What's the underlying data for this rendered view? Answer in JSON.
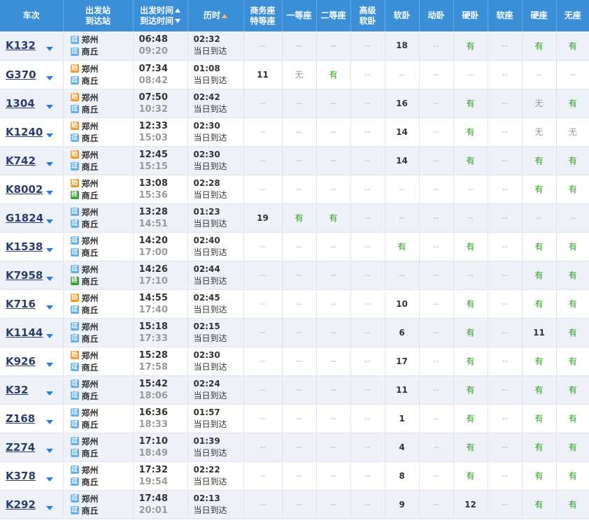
{
  "header": {
    "train": "车次",
    "from_station": "出发站",
    "to_station": "到达站",
    "dep_time": "出发时间",
    "arr_time": "到达时间",
    "duration": "历时",
    "swz_line1": "商务座",
    "swz_line2": "特等座",
    "ydz": "一等座",
    "edz": "二等座",
    "gjrw_line1": "高级",
    "gjrw_line2": "软卧",
    "rw": "软卧",
    "dw": "动卧",
    "yw": "硬卧",
    "rz": "软座",
    "yz": "硬座",
    "wz": "无座"
  },
  "badges": {
    "pass": "过",
    "start": "始",
    "end": "终"
  },
  "rows": [
    {
      "train": "K132",
      "from_type": "pass",
      "from": "郑州",
      "to_type": "pass",
      "to": "商丘",
      "dep": "06:48",
      "arr": "09:20",
      "dur": "02:32",
      "day": "当日到达",
      "seats": [
        "--",
        "--",
        "--",
        "--",
        "18",
        "--",
        "有",
        "--",
        "有",
        "有"
      ]
    },
    {
      "train": "G370",
      "from_type": "start",
      "from": "郑州",
      "to_type": "pass",
      "to": "商丘",
      "dep": "07:34",
      "arr": "08:42",
      "dur": "01:08",
      "day": "当日到达",
      "seats": [
        "11",
        "无",
        "有",
        "--",
        "--",
        "--",
        "--",
        "--",
        "--",
        "--"
      ]
    },
    {
      "train": "1304",
      "from_type": "start",
      "from": "郑州",
      "to_type": "pass",
      "to": "商丘",
      "dep": "07:50",
      "arr": "10:32",
      "dur": "02:42",
      "day": "当日到达",
      "seats": [
        "--",
        "--",
        "--",
        "--",
        "16",
        "--",
        "有",
        "--",
        "无",
        "有"
      ]
    },
    {
      "train": "K1240",
      "from_type": "start",
      "from": "郑州",
      "to_type": "pass",
      "to": "商丘",
      "dep": "12:33",
      "arr": "15:03",
      "dur": "02:30",
      "day": "当日到达",
      "seats": [
        "--",
        "--",
        "--",
        "--",
        "14",
        "--",
        "有",
        "--",
        "无",
        "无"
      ]
    },
    {
      "train": "K742",
      "from_type": "start",
      "from": "郑州",
      "to_type": "pass",
      "to": "商丘",
      "dep": "12:45",
      "arr": "15:15",
      "dur": "02:30",
      "day": "当日到达",
      "seats": [
        "--",
        "--",
        "--",
        "--",
        "14",
        "--",
        "有",
        "--",
        "有",
        "有"
      ]
    },
    {
      "train": "K8002",
      "from_type": "start",
      "from": "郑州",
      "to_type": "end",
      "to": "商丘",
      "dep": "13:08",
      "arr": "15:36",
      "dur": "02:28",
      "day": "当日到达",
      "seats": [
        "--",
        "--",
        "--",
        "--",
        "--",
        "--",
        "--",
        "--",
        "有",
        "有"
      ]
    },
    {
      "train": "G1824",
      "from_type": "pass",
      "from": "郑州",
      "to_type": "pass",
      "to": "商丘",
      "dep": "13:28",
      "arr": "14:51",
      "dur": "01:23",
      "day": "当日到达",
      "seats": [
        "19",
        "有",
        "有",
        "--",
        "--",
        "--",
        "--",
        "--",
        "--",
        "--"
      ]
    },
    {
      "train": "K1538",
      "from_type": "pass",
      "from": "郑州",
      "to_type": "pass",
      "to": "商丘",
      "dep": "14:20",
      "arr": "17:00",
      "dur": "02:40",
      "day": "当日到达",
      "seats": [
        "--",
        "--",
        "--",
        "--",
        "有",
        "--",
        "有",
        "--",
        "有",
        "有"
      ]
    },
    {
      "train": "K7958",
      "from_type": "pass",
      "from": "郑州",
      "to_type": "end",
      "to": "商丘",
      "dep": "14:26",
      "arr": "17:10",
      "dur": "02:44",
      "day": "当日到达",
      "seats": [
        "--",
        "--",
        "--",
        "--",
        "--",
        "--",
        "--",
        "--",
        "有",
        "有"
      ]
    },
    {
      "train": "K716",
      "from_type": "start",
      "from": "郑州",
      "to_type": "pass",
      "to": "商丘",
      "dep": "14:55",
      "arr": "17:40",
      "dur": "02:45",
      "day": "当日到达",
      "seats": [
        "--",
        "--",
        "--",
        "--",
        "10",
        "--",
        "有",
        "--",
        "有",
        "有"
      ]
    },
    {
      "train": "K1144",
      "from_type": "pass",
      "from": "郑州",
      "to_type": "pass",
      "to": "商丘",
      "dep": "15:18",
      "arr": "17:33",
      "dur": "02:15",
      "day": "当日到达",
      "seats": [
        "--",
        "--",
        "--",
        "--",
        "6",
        "--",
        "有",
        "--",
        "11",
        "有"
      ]
    },
    {
      "train": "K926",
      "from_type": "start",
      "from": "郑州",
      "to_type": "pass",
      "to": "商丘",
      "dep": "15:28",
      "arr": "17:58",
      "dur": "02:30",
      "day": "当日到达",
      "seats": [
        "--",
        "--",
        "--",
        "--",
        "17",
        "--",
        "有",
        "--",
        "有",
        "有"
      ]
    },
    {
      "train": "K32",
      "from_type": "pass",
      "from": "郑州",
      "to_type": "pass",
      "to": "商丘",
      "dep": "15:42",
      "arr": "18:06",
      "dur": "02:24",
      "day": "当日到达",
      "seats": [
        "--",
        "--",
        "--",
        "--",
        "11",
        "--",
        "有",
        "--",
        "有",
        "有"
      ]
    },
    {
      "train": "Z168",
      "from_type": "pass",
      "from": "郑州",
      "to_type": "pass",
      "to": "商丘",
      "dep": "16:36",
      "arr": "18:33",
      "dur": "01:57",
      "day": "当日到达",
      "seats": [
        "--",
        "--",
        "--",
        "--",
        "1",
        "--",
        "有",
        "--",
        "有",
        "有"
      ]
    },
    {
      "train": "Z274",
      "from_type": "pass",
      "from": "郑州",
      "to_type": "pass",
      "to": "商丘",
      "dep": "17:10",
      "arr": "18:49",
      "dur": "01:39",
      "day": "当日到达",
      "seats": [
        "--",
        "--",
        "--",
        "--",
        "4",
        "--",
        "有",
        "--",
        "有",
        "有"
      ]
    },
    {
      "train": "K378",
      "from_type": "pass",
      "from": "郑州",
      "to_type": "pass",
      "to": "商丘",
      "dep": "17:32",
      "arr": "19:54",
      "dur": "02:22",
      "day": "当日到达",
      "seats": [
        "--",
        "--",
        "--",
        "--",
        "8",
        "--",
        "有",
        "--",
        "有",
        "有"
      ]
    },
    {
      "train": "K292",
      "from_type": "pass",
      "from": "郑州",
      "to_type": "pass",
      "to": "商丘",
      "dep": "17:48",
      "arr": "20:01",
      "dur": "02:13",
      "day": "当日到达",
      "seats": [
        "--",
        "--",
        "--",
        "--",
        "9",
        "--",
        "12",
        "--",
        "有",
        "有"
      ]
    }
  ],
  "colors": {
    "header_bg": "#3a8fd6",
    "available": "#2a9d1b",
    "train_link": "#2b3e6b",
    "badge_pass": "#6ab0e6",
    "badge_start": "#f09a2c",
    "badge_end": "#3f9d35"
  }
}
